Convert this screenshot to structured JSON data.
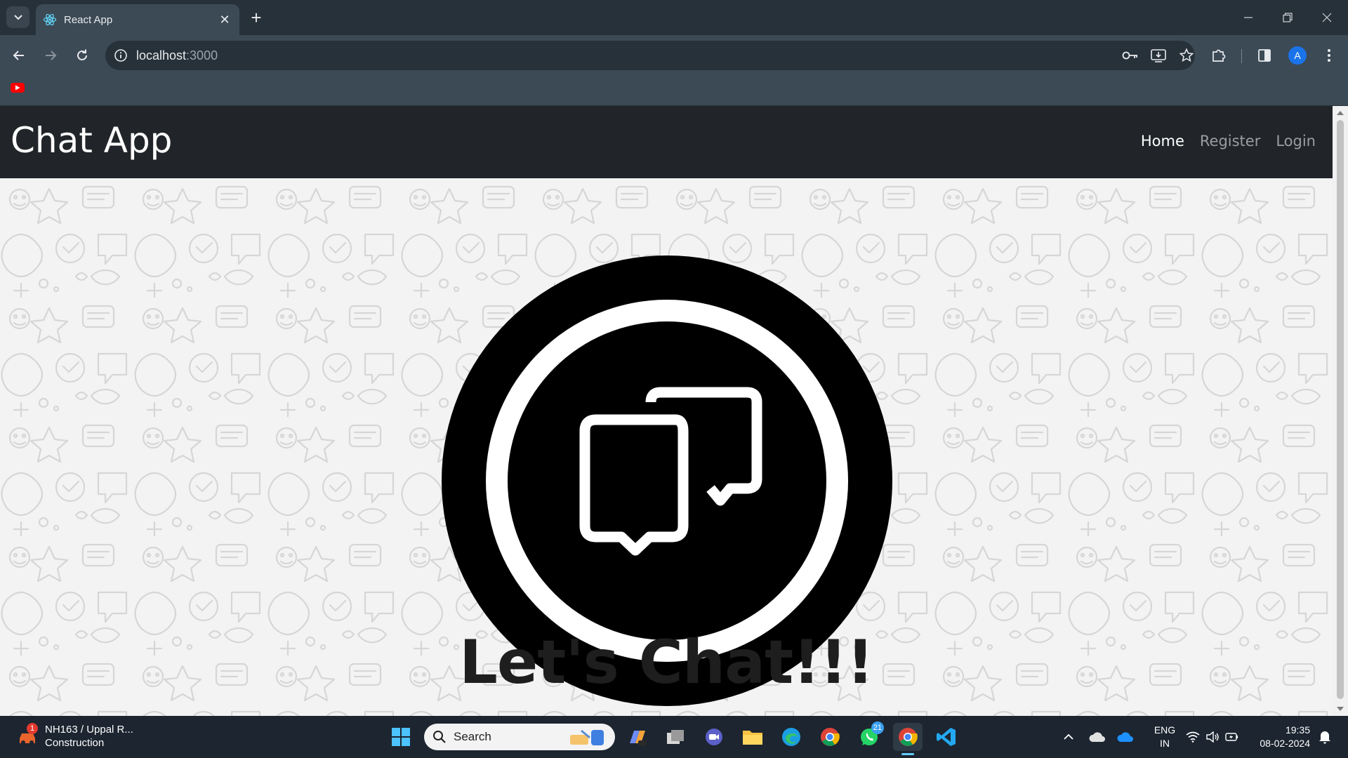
{
  "browser": {
    "tab_title": "React App",
    "url_host": "localhost",
    "url_port": ":3000",
    "profile_initial": "A"
  },
  "page": {
    "brand": "Chat App",
    "nav": [
      "Home",
      "Register",
      "Login"
    ],
    "hero_text": "Let's Chat!!!"
  },
  "taskbar": {
    "weather_title": "NH163 / Uppal R...",
    "weather_sub": "Construction",
    "weather_badge": "1",
    "search_placeholder": "Search",
    "whatsapp_badge": "21",
    "lang_line1": "ENG",
    "lang_line2": "IN",
    "time": "19:35",
    "date": "08-02-2024"
  },
  "colors": {
    "navbar_bg": "#212529",
    "hero_text": "#1e1e1e",
    "browser_tabbar": "#27313a",
    "browser_toolbar": "#3c4a56",
    "taskbar_bg": "#1c2530"
  }
}
